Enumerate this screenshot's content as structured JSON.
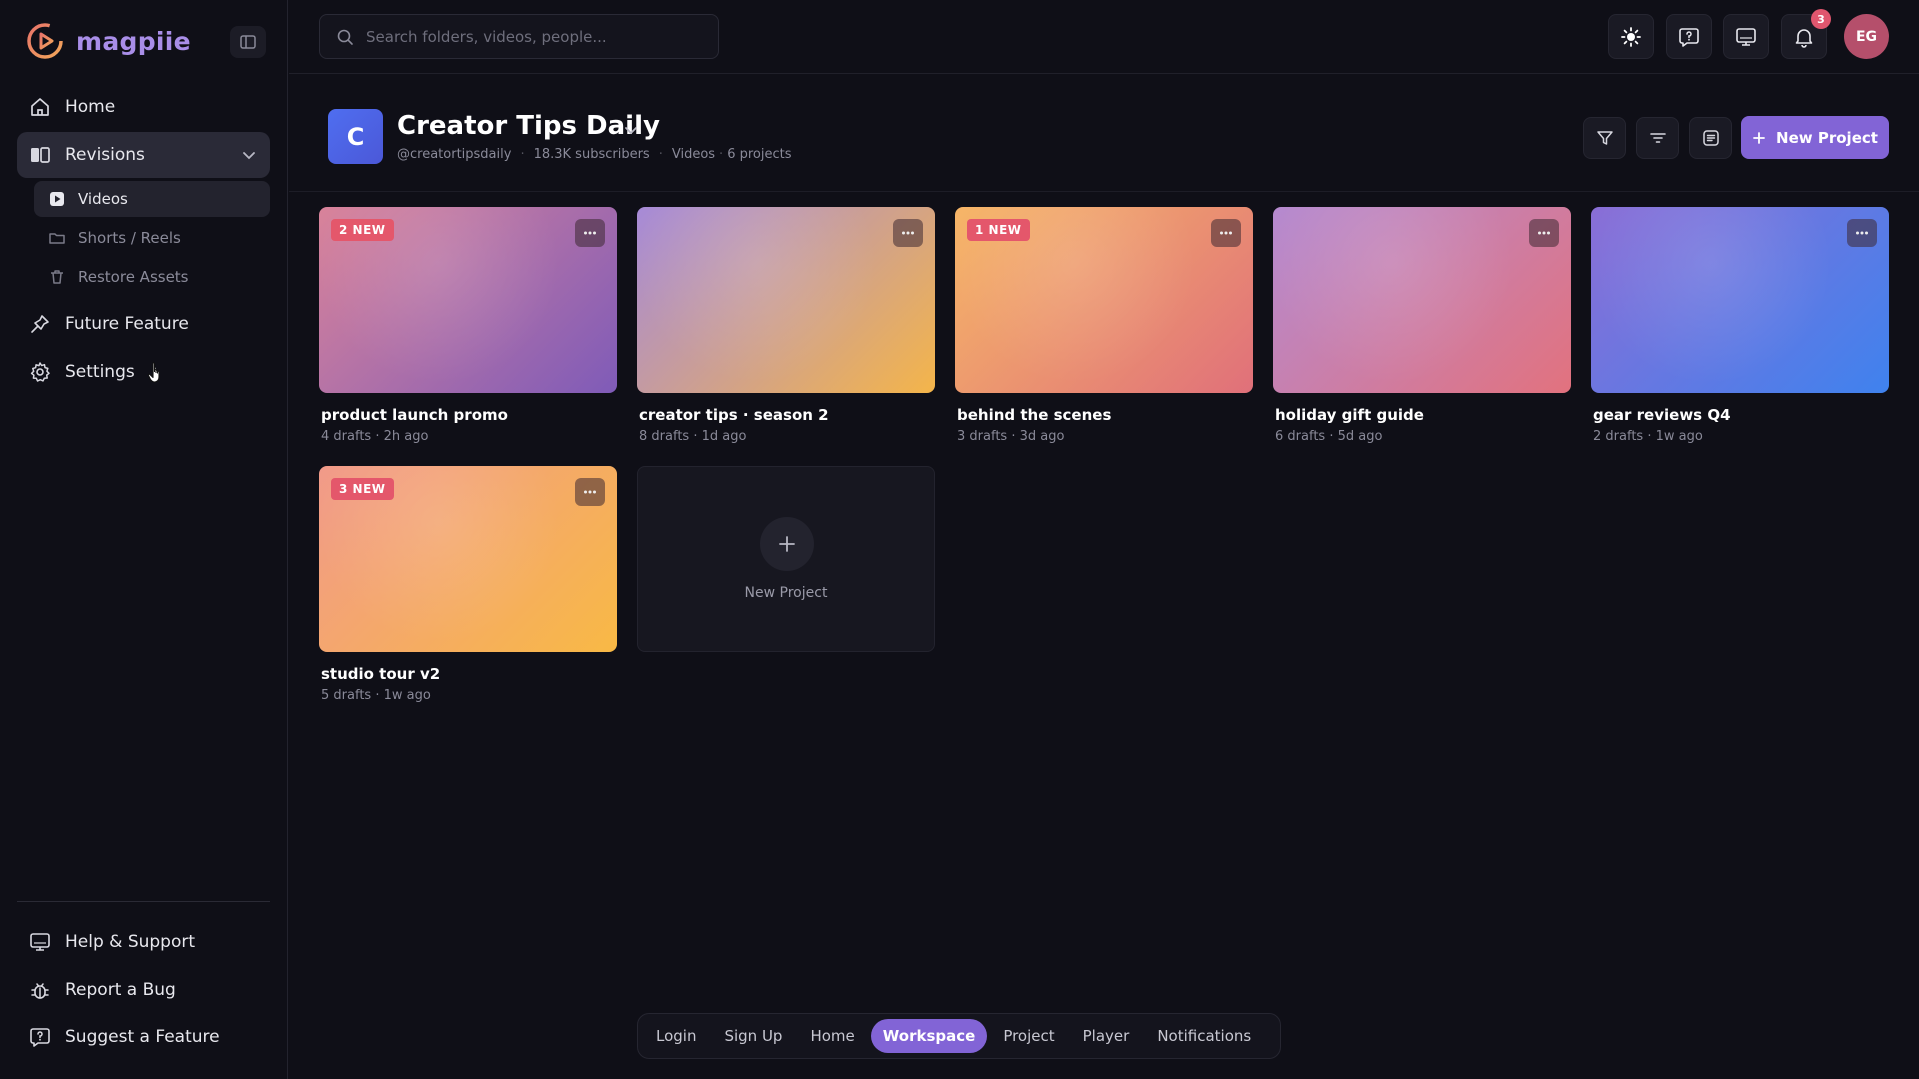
{
  "app": {
    "name": "magpiie"
  },
  "search": {
    "placeholder": "Search folders, videos, people..."
  },
  "sidebar": {
    "nav": [
      {
        "label": "Home"
      },
      {
        "label": "Revisions"
      },
      {
        "label": "Future Feature"
      },
      {
        "label": "Settings"
      }
    ],
    "sub_items": [
      {
        "label": "Videos"
      },
      {
        "label": "Shorts / Reels"
      },
      {
        "label": "Restore Assets"
      }
    ],
    "footer": [
      {
        "label": "Help & Support"
      },
      {
        "label": "Report a Bug"
      },
      {
        "label": "Suggest a Feature"
      }
    ]
  },
  "header": {
    "notification_count": "3",
    "avatar_initials": "EG"
  },
  "channel": {
    "initial": "C",
    "title": "Creator Tips Daily",
    "handle": "@creatortipsdaily",
    "subscribers": "18.3K subscribers",
    "section": "Videos",
    "projects": "6 projects",
    "new_project_label": "New Project"
  },
  "projects": [
    {
      "title": "product launch promo",
      "meta": "4 drafts · 2h ago",
      "badge": "2 NEW",
      "gradient": [
        "#d9839a",
        "#7f5bb8"
      ]
    },
    {
      "title": "creator tips · season 2",
      "meta": "8 drafts · 1d ago",
      "badge": "",
      "gradient": [
        "#a68ad8",
        "#f4b54a"
      ]
    },
    {
      "title": "behind the scenes",
      "meta": "3 drafts · 3d ago",
      "badge": "1 NEW",
      "gradient": [
        "#f6b667",
        "#e0707a"
      ]
    },
    {
      "title": "holiday gift guide",
      "meta": "6 drafts · 5d ago",
      "badge": "",
      "gradient": [
        "#b58ad0",
        "#e2727e"
      ]
    },
    {
      "title": "gear reviews Q4",
      "meta": "2 drafts · 1w ago",
      "badge": "",
      "gradient": [
        "#8a6ed6",
        "#3f82ee"
      ]
    },
    {
      "title": "studio tour v2",
      "meta": "5 drafts · 1w ago",
      "badge": "3 NEW",
      "gradient": [
        "#f19a8a",
        "#f8b945"
      ]
    }
  ],
  "new_card": {
    "label": "New Project"
  },
  "bottom_nav": [
    {
      "label": "Login"
    },
    {
      "label": "Sign Up"
    },
    {
      "label": "Home"
    },
    {
      "label": "Workspace"
    },
    {
      "label": "Project"
    },
    {
      "label": "Player"
    },
    {
      "label": "Notifications"
    }
  ],
  "colors": {
    "accent": "#8264d6",
    "badge": "#e4576b",
    "brand": "#a98ee8"
  }
}
